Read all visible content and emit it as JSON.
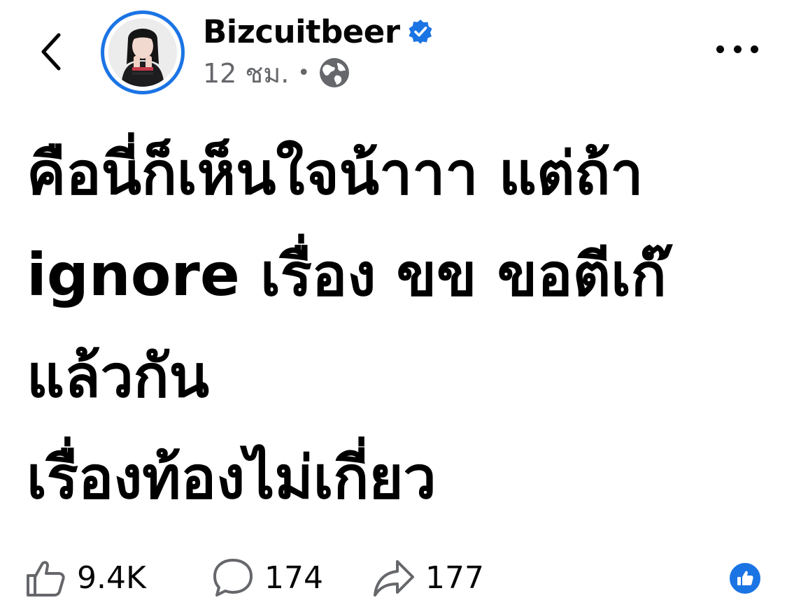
{
  "header": {
    "back_icon": "chevron-left-icon",
    "author_name": "Bizcuitbeer",
    "verified_icon": "verified-badge-icon",
    "time": "12 ชม.",
    "separator": "•",
    "audience_icon": "globe-icon",
    "more_icon": "more-horizontal-icon"
  },
  "post": {
    "text": "คือนี่ก็เห็นใจน้าาา แต่ถ้า\nignore เรื่อง ขข ขอตีเก๊\nแล้วกัน\nเรื่องท้องไม่เกี่ยว"
  },
  "engagement": {
    "likes": "9.4K",
    "comments": "174",
    "shares": "177",
    "like_icon": "thumbs-up-outline-icon",
    "comment_icon": "comment-bubble-icon",
    "share_icon": "share-arrow-icon",
    "reaction_icon": "like-reaction-badge-icon"
  },
  "colors": {
    "accent": "#1b74e4",
    "text": "#050505",
    "secondary": "#65676b",
    "background": "#ffffff"
  }
}
